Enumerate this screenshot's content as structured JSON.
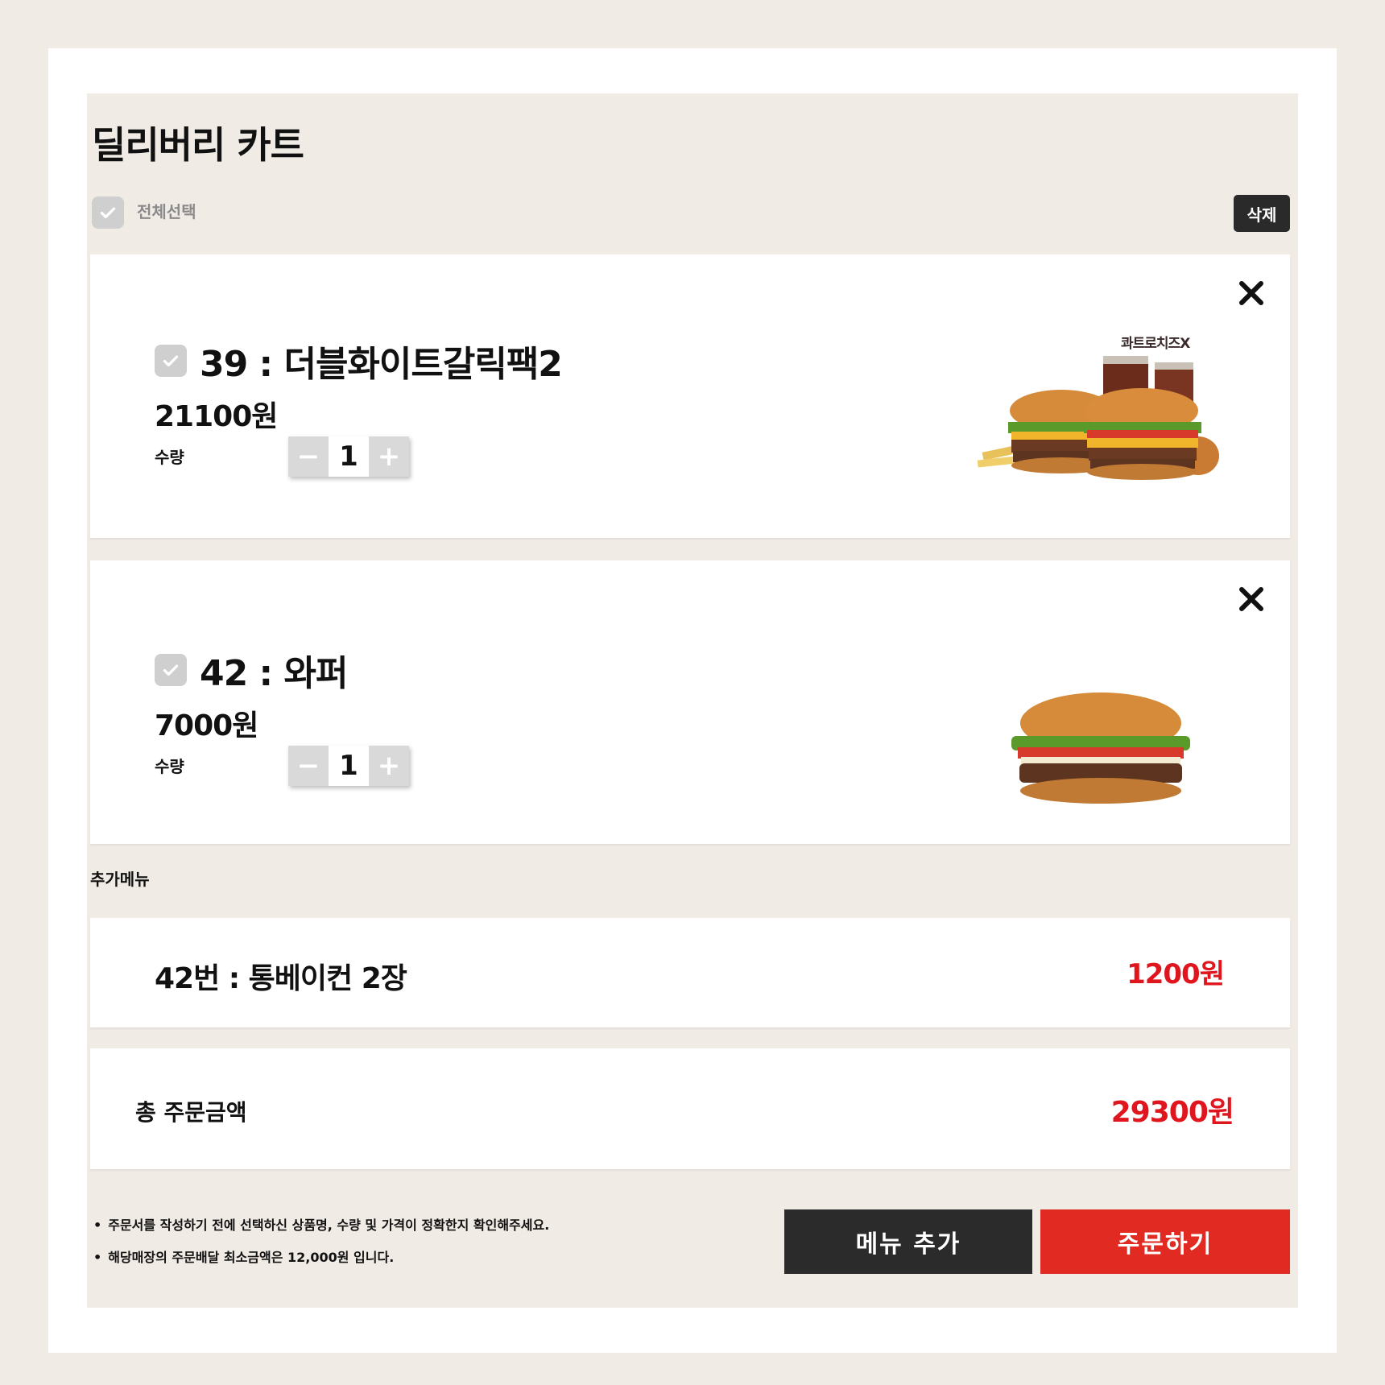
{
  "cart": {
    "title": "딜리버리 카트",
    "select_all_label": "전체선택",
    "delete_label": "삭제"
  },
  "items": [
    {
      "name": "39 : 더블화이트갈릭팩2",
      "price": "21100원",
      "qty_label": "수량",
      "qty": "1",
      "image_tag": "콰트로치즈X",
      "minus": "−",
      "plus": "+"
    },
    {
      "name": "42 : 와퍼",
      "price": "7000원",
      "qty_label": "수량",
      "qty": "1",
      "minus": "−",
      "plus": "+"
    }
  ],
  "addons": {
    "label": "추가메뉴",
    "items": [
      {
        "name": "42번 : 통베이컨 2장",
        "price": "1200원"
      }
    ]
  },
  "total": {
    "label": "총 주문금액",
    "value": "29300원"
  },
  "notes": [
    "주문서를 작성하기 전에 선택하신 상품명, 수량 및 가격이 정확한지 확인해주세요.",
    "해당매장의 주문배달 최소금액은 12,000원 입니다."
  ],
  "buttons": {
    "add_menu": "메뉴 추가",
    "order": "주문하기"
  },
  "colors": {
    "accent_red": "#e0161e",
    "order_button": "#e12a21",
    "dark_button": "#2b2b2b",
    "background": "#f1ebe6"
  }
}
